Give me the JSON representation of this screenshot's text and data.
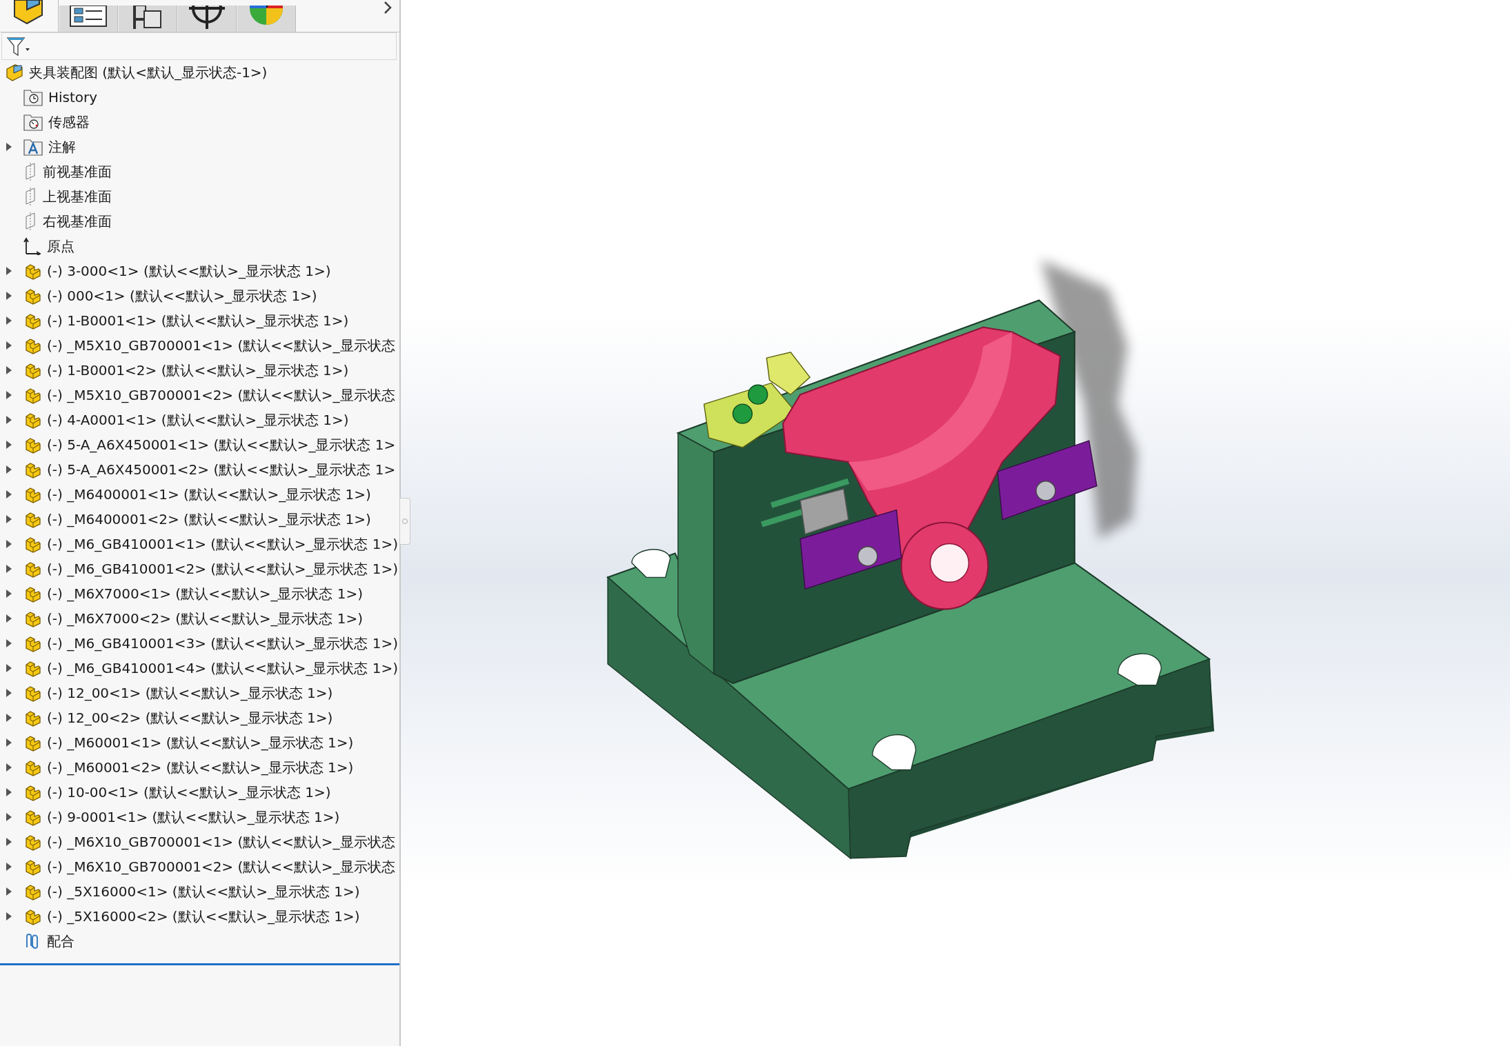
{
  "panel_tabs": [
    {
      "kind": "assembly",
      "selected": true
    },
    {
      "kind": "properties",
      "selected": false
    },
    {
      "kind": "configurations",
      "selected": false
    },
    {
      "kind": "dimxpert",
      "selected": false
    },
    {
      "kind": "appearance",
      "selected": false
    }
  ],
  "tree": {
    "label": "夹具装配图  (默认<默认_显示状态-1>)",
    "kind": "assembly",
    "children": [
      {
        "label": "History",
        "kind": "history",
        "expandable": false
      },
      {
        "label": "传感器",
        "kind": "sensor",
        "expandable": false
      },
      {
        "label": "注解",
        "kind": "annotation",
        "expandable": true
      },
      {
        "label": "前视基准面",
        "kind": "plane",
        "expandable": false
      },
      {
        "label": "上视基准面",
        "kind": "plane",
        "expandable": false
      },
      {
        "label": "右视基准面",
        "kind": "plane",
        "expandable": false
      },
      {
        "label": "原点",
        "kind": "origin",
        "expandable": false
      },
      {
        "label": "(-) 3-000<1> (默认<<默认>_显示状态 1>)",
        "kind": "part",
        "expandable": true
      },
      {
        "label": "(-) 000<1> (默认<<默认>_显示状态 1>)",
        "kind": "part",
        "expandable": true
      },
      {
        "label": "(-) 1-B0001<1> (默认<<默认>_显示状态 1>)",
        "kind": "part",
        "expandable": true
      },
      {
        "label": "(-) _M5X10_GB700001<1> (默认<<默认>_显示状态",
        "kind": "part",
        "expandable": true
      },
      {
        "label": "(-) 1-B0001<2> (默认<<默认>_显示状态 1>)",
        "kind": "part",
        "expandable": true
      },
      {
        "label": "(-) _M5X10_GB700001<2> (默认<<默认>_显示状态",
        "kind": "part",
        "expandable": true
      },
      {
        "label": "(-) 4-A0001<1> (默认<<默认>_显示状态 1>)",
        "kind": "part",
        "expandable": true
      },
      {
        "label": "(-) 5-A_A6X450001<1> (默认<<默认>_显示状态 1>",
        "kind": "part",
        "expandable": true
      },
      {
        "label": "(-) 5-A_A6X450001<2> (默认<<默认>_显示状态 1>",
        "kind": "part",
        "expandable": true
      },
      {
        "label": "(-) _M6400001<1> (默认<<默认>_显示状态 1>)",
        "kind": "part",
        "expandable": true
      },
      {
        "label": "(-) _M6400001<2> (默认<<默认>_显示状态 1>)",
        "kind": "part",
        "expandable": true
      },
      {
        "label": "(-) _M6_GB410001<1> (默认<<默认>_显示状态 1>)",
        "kind": "part",
        "expandable": true
      },
      {
        "label": "(-) _M6_GB410001<2> (默认<<默认>_显示状态 1>)",
        "kind": "part",
        "expandable": true
      },
      {
        "label": "(-) _M6X7000<1> (默认<<默认>_显示状态 1>)",
        "kind": "part",
        "expandable": true
      },
      {
        "label": "(-) _M6X7000<2> (默认<<默认>_显示状态 1>)",
        "kind": "part",
        "expandable": true
      },
      {
        "label": "(-) _M6_GB410001<3> (默认<<默认>_显示状态 1>)",
        "kind": "part",
        "expandable": true
      },
      {
        "label": "(-) _M6_GB410001<4> (默认<<默认>_显示状态 1>)",
        "kind": "part",
        "expandable": true
      },
      {
        "label": "(-) 12_00<1> (默认<<默认>_显示状态 1>)",
        "kind": "part",
        "expandable": true
      },
      {
        "label": "(-) 12_00<2> (默认<<默认>_显示状态 1>)",
        "kind": "part",
        "expandable": true
      },
      {
        "label": "(-) _M60001<1> (默认<<默认>_显示状态 1>)",
        "kind": "part",
        "expandable": true
      },
      {
        "label": "(-) _M60001<2> (默认<<默认>_显示状态 1>)",
        "kind": "part",
        "expandable": true
      },
      {
        "label": "(-) 10-00<1> (默认<<默认>_显示状态 1>)",
        "kind": "part",
        "expandable": true
      },
      {
        "label": "(-) 9-0001<1> (默认<<默认>_显示状态 1>)",
        "kind": "part",
        "expandable": true
      },
      {
        "label": "(-) _M6X10_GB700001<1> (默认<<默认>_显示状态",
        "kind": "part",
        "expandable": true
      },
      {
        "label": "(-) _M6X10_GB700001<2> (默认<<默认>_显示状态",
        "kind": "part",
        "expandable": true
      },
      {
        "label": "(-) _5X16000<1> (默认<<默认>_显示状态 1>)",
        "kind": "part",
        "expandable": true
      },
      {
        "label": "(-) _5X16000<2> (默认<<默认>_显示状态 1>)",
        "kind": "part",
        "expandable": true
      },
      {
        "label": "配合",
        "kind": "mate",
        "expandable": false
      }
    ]
  }
}
